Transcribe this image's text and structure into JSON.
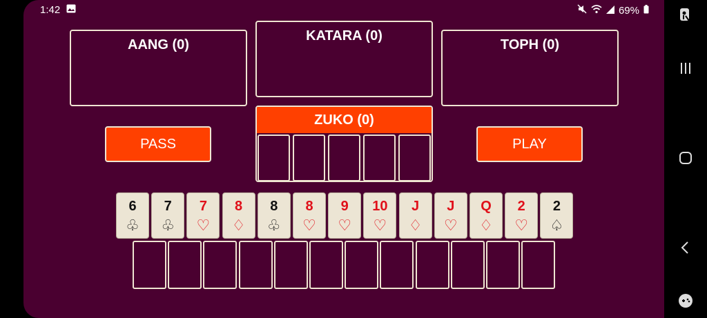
{
  "status_bar": {
    "time": "1:42",
    "battery": "69%",
    "icons": [
      "image-icon",
      "mute-icon",
      "wifi-icon",
      "signal-icon",
      "battery-icon"
    ]
  },
  "players": {
    "aang": "AANG (0)",
    "katara": "KATARA (0)",
    "toph": "TOPH (0)",
    "zuko": "ZUKO (0)"
  },
  "buttons": {
    "pass": "PASS",
    "play": "PLAY"
  },
  "hand": [
    {
      "rank": "6",
      "suit": "♧",
      "color": "black"
    },
    {
      "rank": "7",
      "suit": "♧",
      "color": "black"
    },
    {
      "rank": "7",
      "suit": "♡",
      "color": "red"
    },
    {
      "rank": "8",
      "suit": "♢",
      "color": "red"
    },
    {
      "rank": "8",
      "suit": "♧",
      "color": "black"
    },
    {
      "rank": "8",
      "suit": "♡",
      "color": "red"
    },
    {
      "rank": "9",
      "suit": "♡",
      "color": "red"
    },
    {
      "rank": "10",
      "suit": "♡",
      "color": "red"
    },
    {
      "rank": "J",
      "suit": "♢",
      "color": "red"
    },
    {
      "rank": "J",
      "suit": "♡",
      "color": "red"
    },
    {
      "rank": "Q",
      "suit": "♢",
      "color": "red"
    },
    {
      "rank": "2",
      "suit": "♡",
      "color": "red"
    },
    {
      "rank": "2",
      "suit": "♤",
      "color": "black"
    }
  ],
  "colors": {
    "background": "#4a0030",
    "accent": "#ff4000",
    "card": "#ece5d4",
    "red_suit": "#e0101a"
  }
}
